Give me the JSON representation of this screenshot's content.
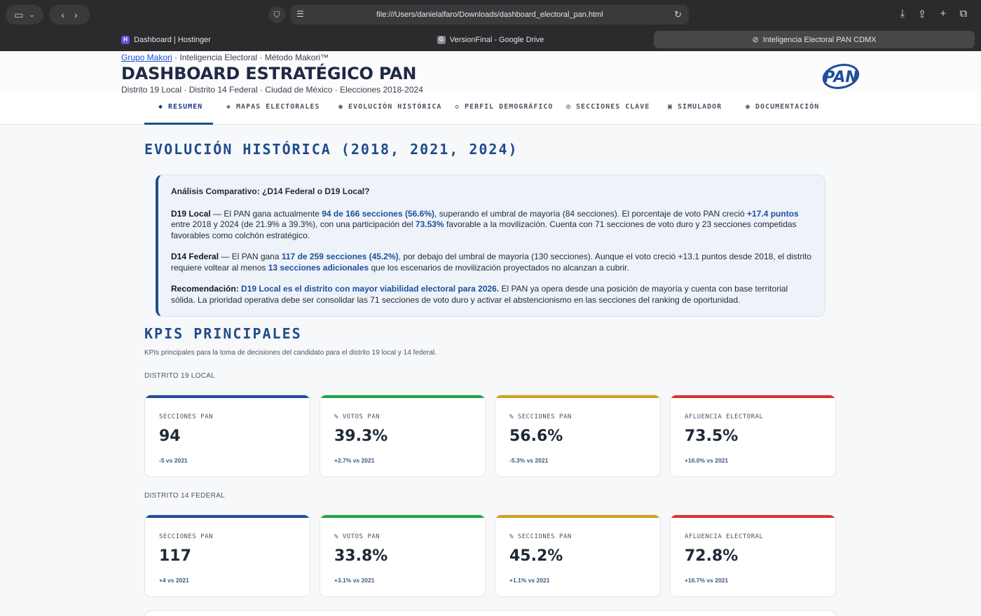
{
  "browser": {
    "url": "file:///Users/danielalfaro/Downloads/dashboard_electoral_pan.html",
    "tabs": [
      {
        "label": "Dashboard | Hostinger",
        "active": false
      },
      {
        "label": "VersionFinal - Google Drive",
        "active": false
      },
      {
        "label": "Inteligencia Electoral PAN CDMX",
        "active": true
      }
    ]
  },
  "header": {
    "crumb_link": "Grupo Makori",
    "crumb_rest": " · Inteligencia Electoral · Método Makori™",
    "title": "DASHBOARD ESTRATÉGICO PAN",
    "subtitle": "Distrito 19 Local · Distrito 14 Federal · Ciudad de México · Elecciones 2018-2024",
    "logo_text": "PAN"
  },
  "nav": [
    {
      "label": "◆ RESUMEN",
      "active": true
    },
    {
      "label": "◈ MAPAS ELECTORALES",
      "active": false
    },
    {
      "label": "◉ EVOLUCIÓN HISTÓRICA",
      "active": false
    },
    {
      "label": "◇ PERFIL DEMOGRÁFICO",
      "active": false
    },
    {
      "label": "◎ SECCIONES CLAVE",
      "active": false
    },
    {
      "label": "▣ SIMULADOR",
      "active": false
    },
    {
      "label": "◉ DOCUMENTACIÓN",
      "active": false
    }
  ],
  "evolucion": {
    "heading": "EVOLUCIÓN HISTÓRICA (2018, 2021, 2024)",
    "analysis_title": "Análisis Comparativo: ¿D14 Federal o D19 Local?",
    "p1": {
      "lead": "D19 Local",
      "t1": " — El PAN gana actualmente ",
      "h1": "94 de 166 secciones (56.6%)",
      "t2": ", superando el umbral de mayoría (84 secciones). El porcentaje de voto PAN creció ",
      "h2": "+17.4 puntos",
      "t3": " entre 2018 y 2024 (de 21.9% a 39.3%), con una participación del ",
      "h3": "73.53%",
      "t4": " favorable a la movilización. Cuenta con 71 secciones de voto duro y 23 secciones competidas favorables como colchón estratégico."
    },
    "p2": {
      "lead": "D14 Federal",
      "t1": " — El PAN gana ",
      "h1": "117 de 259 secciones (45.2%)",
      "t2": ", por debajo del umbral de mayoría (130 secciones). Aunque el voto creció +13.1 puntos desde 2018, el distrito requiere voltear al menos ",
      "h2": "13 secciones adicionales",
      "t3": " que los escenarios de movilización proyectados no alcanzan a cubrir."
    },
    "p3": {
      "lead": "Recomendación:",
      "h1": "D19 Local es el distrito con mayor viabilidad electoral para 2026.",
      "t1": " El PAN ya opera desde una posición de mayoría y cuenta con base territorial sólida. La prioridad operativa debe ser consolidar las 71 secciones de voto duro y activar el abstencionismo en las secciones del ranking de oportunidad."
    }
  },
  "kpis": {
    "heading": "KPIS PRINCIPALES",
    "subtitle": "KPIs principales para la toma de decisiones del candidato para el distrito 19 local y 14 federal.",
    "colors": {
      "blue": "#1f4e9c",
      "green": "#22a447",
      "gold": "#d4a017",
      "red": "#d9342b"
    },
    "d19": {
      "label": "DISTRITO 19 LOCAL",
      "cards": [
        {
          "label": "SECCIONES PAN",
          "value": "94",
          "change": "-5 vs 2021"
        },
        {
          "label": "% VOTOS PAN",
          "value": "39.3%",
          "change": "+2.7% vs 2021"
        },
        {
          "label": "% SECCIONES PAN",
          "value": "56.6%",
          "change": "-5.3% vs 2021"
        },
        {
          "label": "AFLUENCIA ELECTORAL",
          "value": "73.5%",
          "change": "+16.0% vs 2021"
        }
      ]
    },
    "d14": {
      "label": "DISTRITO 14 FEDERAL",
      "cards": [
        {
          "label": "SECCIONES PAN",
          "value": "117",
          "change": "+4 vs 2021"
        },
        {
          "label": "% VOTOS PAN",
          "value": "33.8%",
          "change": "+3.1% vs 2021"
        },
        {
          "label": "% SECCIONES PAN",
          "value": "45.2%",
          "change": "+1.1% vs 2021"
        },
        {
          "label": "AFLUENCIA ELECTORAL",
          "value": "72.8%",
          "change": "+16.7% vs 2021"
        }
      ]
    }
  }
}
